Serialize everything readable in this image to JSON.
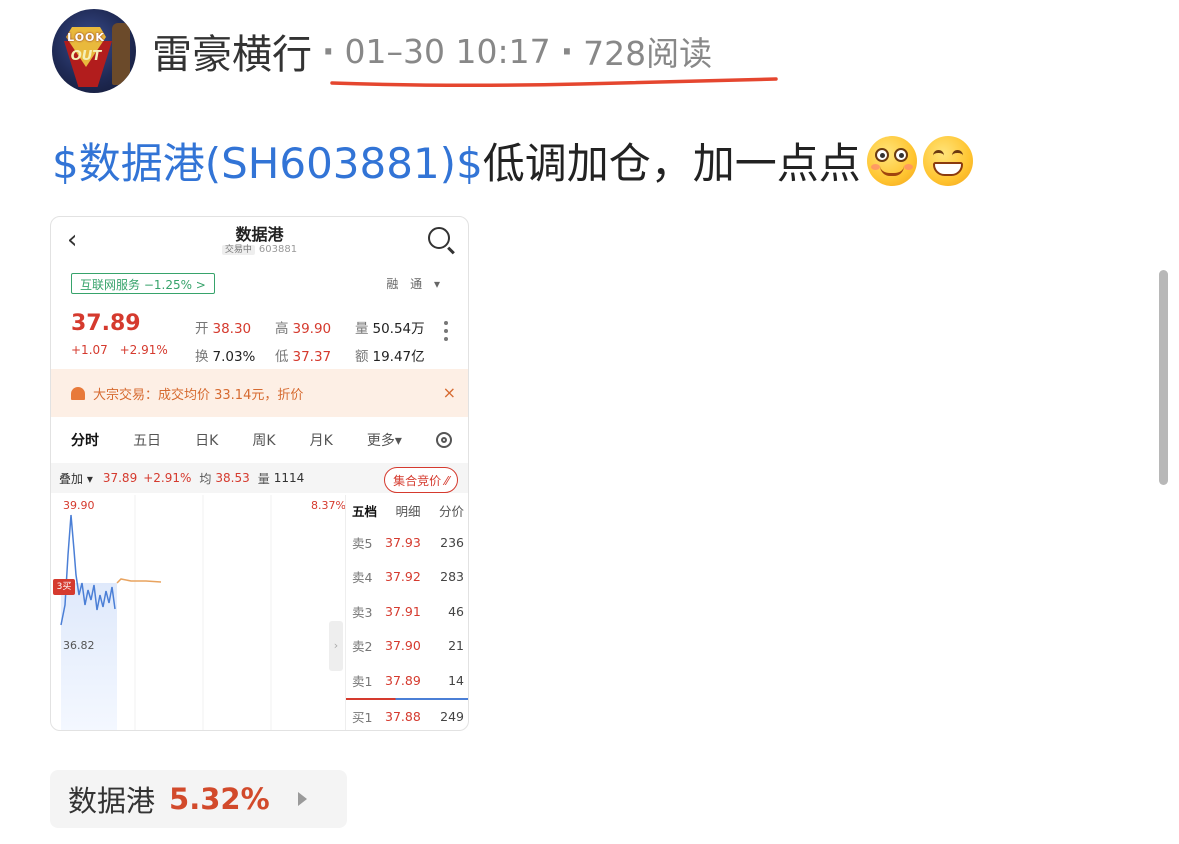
{
  "post": {
    "author": "雷豪横行",
    "avatar_icon": "superhero-avatar",
    "avatar_text_top": "LOOK",
    "avatar_text_bottom": "OUT",
    "date": "01–30 10:17",
    "reads": "728阅读",
    "underline_color": "#e5462f",
    "stock_link": "$数据港(SH603881)$",
    "body": "低调加仓，加一点点",
    "emojis": [
      "emoji-goofy-face",
      "emoji-grinning-face"
    ]
  },
  "screenshot": {
    "nav": {
      "back_icon": "chevron-left-icon",
      "title": "数据港",
      "status_tag": "交易中",
      "code": "603881",
      "search_icon": "search-icon"
    },
    "industry": "互联网服务 −1.25% >",
    "rong_tong": "融 通 ▾",
    "price": "37.89",
    "change": "+1.07  +2.91%",
    "stats": [
      {
        "k": "开",
        "v": "38.30",
        "color": "red"
      },
      {
        "k": "高",
        "v": "39.90",
        "color": "red"
      },
      {
        "k": "量",
        "v": "50.54万",
        "color": "plain"
      },
      {
        "k": "换",
        "v": "7.03%",
        "color": "plain"
      },
      {
        "k": "低",
        "v": "37.37",
        "color": "red"
      },
      {
        "k": "额",
        "v": "19.47亿",
        "color": "plain"
      }
    ],
    "notice": "大宗交易：成交均价 33.14元，折价",
    "notice_close": "×",
    "tabs": [
      "分时",
      "五日",
      "日K",
      "周K",
      "月K",
      "更多▾"
    ],
    "overlay": {
      "label": "叠加 ▾",
      "price": "37.89",
      "pct": "+2.91%",
      "avg_label": "均",
      "avg": "38.53",
      "vol_label": "量",
      "vol": "1114"
    },
    "auction_button": "集合竞价 ⁄⁄",
    "chart_labels": {
      "high": "39.90",
      "pct": "8.37%",
      "low": "36.82",
      "buy_marker": "3买",
      "collapse": "›"
    },
    "book_tabs": [
      "五档",
      "明细",
      "分价"
    ],
    "book": [
      {
        "label": "卖5",
        "price": "37.93",
        "vol": "236"
      },
      {
        "label": "卖4",
        "price": "37.92",
        "vol": "283"
      },
      {
        "label": "卖3",
        "price": "37.91",
        "vol": "46"
      },
      {
        "label": "卖2",
        "price": "37.90",
        "vol": "21"
      },
      {
        "label": "卖1",
        "price": "37.89",
        "vol": "14"
      },
      {
        "label": "买1",
        "price": "37.88",
        "vol": "249"
      }
    ]
  },
  "chip": {
    "name": "数据港",
    "pct": "5.32%",
    "arrow_icon": "play-arrow-icon"
  },
  "colors": {
    "link_blue": "#3274d6",
    "up_red": "#d53a2e",
    "chip_red": "#d24a2b"
  }
}
